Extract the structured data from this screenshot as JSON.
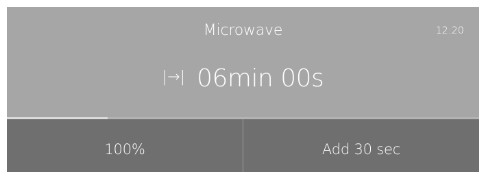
{
  "header": {
    "title": "Microwave",
    "clock": "12:20"
  },
  "timer": {
    "icon": "duration-icon",
    "icon_glyph": "|→|",
    "text": "06min 00s"
  },
  "progress": {
    "fraction": 0.214
  },
  "actions": {
    "power_label": "100%",
    "add_label": "Add 30 sec"
  },
  "colors": {
    "panel": "#a6a6a6",
    "bottom_bar": "#6f6f6f",
    "progress_fill": "#dcdcdc",
    "text": "#ffffff"
  }
}
